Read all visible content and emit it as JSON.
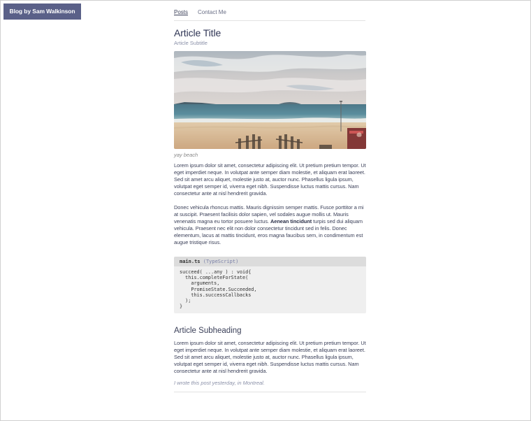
{
  "brand": {
    "label": "Blog by Sam Walkinson",
    "color": "#5a6088"
  },
  "nav": {
    "items": [
      {
        "label": "Posts",
        "active": true
      },
      {
        "label": "Contact Me",
        "active": false
      }
    ]
  },
  "article": {
    "title": "Article Title",
    "subtitle": "Article Subtitle",
    "image_caption": "yay beach",
    "paragraph1": "Lorem ipsum dolor sit amet, consectetur adipiscing elit. Ut pretium pretium tempor. Ut eget imperdiet neque. In volutpat ante semper diam molestie, et aliquam erat laoreet. Sed sit amet arcu aliquet, molestie justo at, auctor nunc. Phasellus ligula ipsum, volutpat eget semper id, viverra eget nibh. Suspendisse luctus mattis cursus. Nam consectetur ante at nisl hendrerit gravida.",
    "paragraph2_before": "Donec vehicula rhoncus mattis. Mauris dignissim semper mattis. Fusce porttitor a mi at suscipit. Praesent facilisis dolor sapien, vel sodales augue mollis ut. Mauris venenatis magna eu tortor posuere luctus. ",
    "paragraph2_bold": "Aenean tincidunt",
    "paragraph2_after": " turpis sed dui aliquam vehicula. Praesent nec elit non dolor consectetur tincidunt sed in felis. Donec elementum, lacus at mattis tincidunt, eros magna faucibus sem, in condimentum est augue tristique risus.",
    "code": {
      "filename": "main.ts",
      "language": "(TypeScript)",
      "body": "succeed( ...any ) : void{\n  this.completeForState(\n    arguments,\n    PromiseState.Succeeded,\n    this.successCallbacks\n  );\n}"
    },
    "subheading": "Article Subheading",
    "paragraph3": "Lorem ipsum dolor sit amet, consectetur adipiscing elit. Ut pretium pretium tempor. Ut eget imperdiet neque. In volutpat ante semper diam molestie, et aliquam erat laoreet. Sed sit amet arcu aliquet, molestie justo at, auctor nunc. Phasellus ligula ipsum, volutpat eget semper id, viverra eget nibh. Suspendisse luctus mattis cursus. Nam consectetur ante at nisl hendrerit gravida.",
    "signoff": "I wrote this post yesterday, in Montreal."
  }
}
